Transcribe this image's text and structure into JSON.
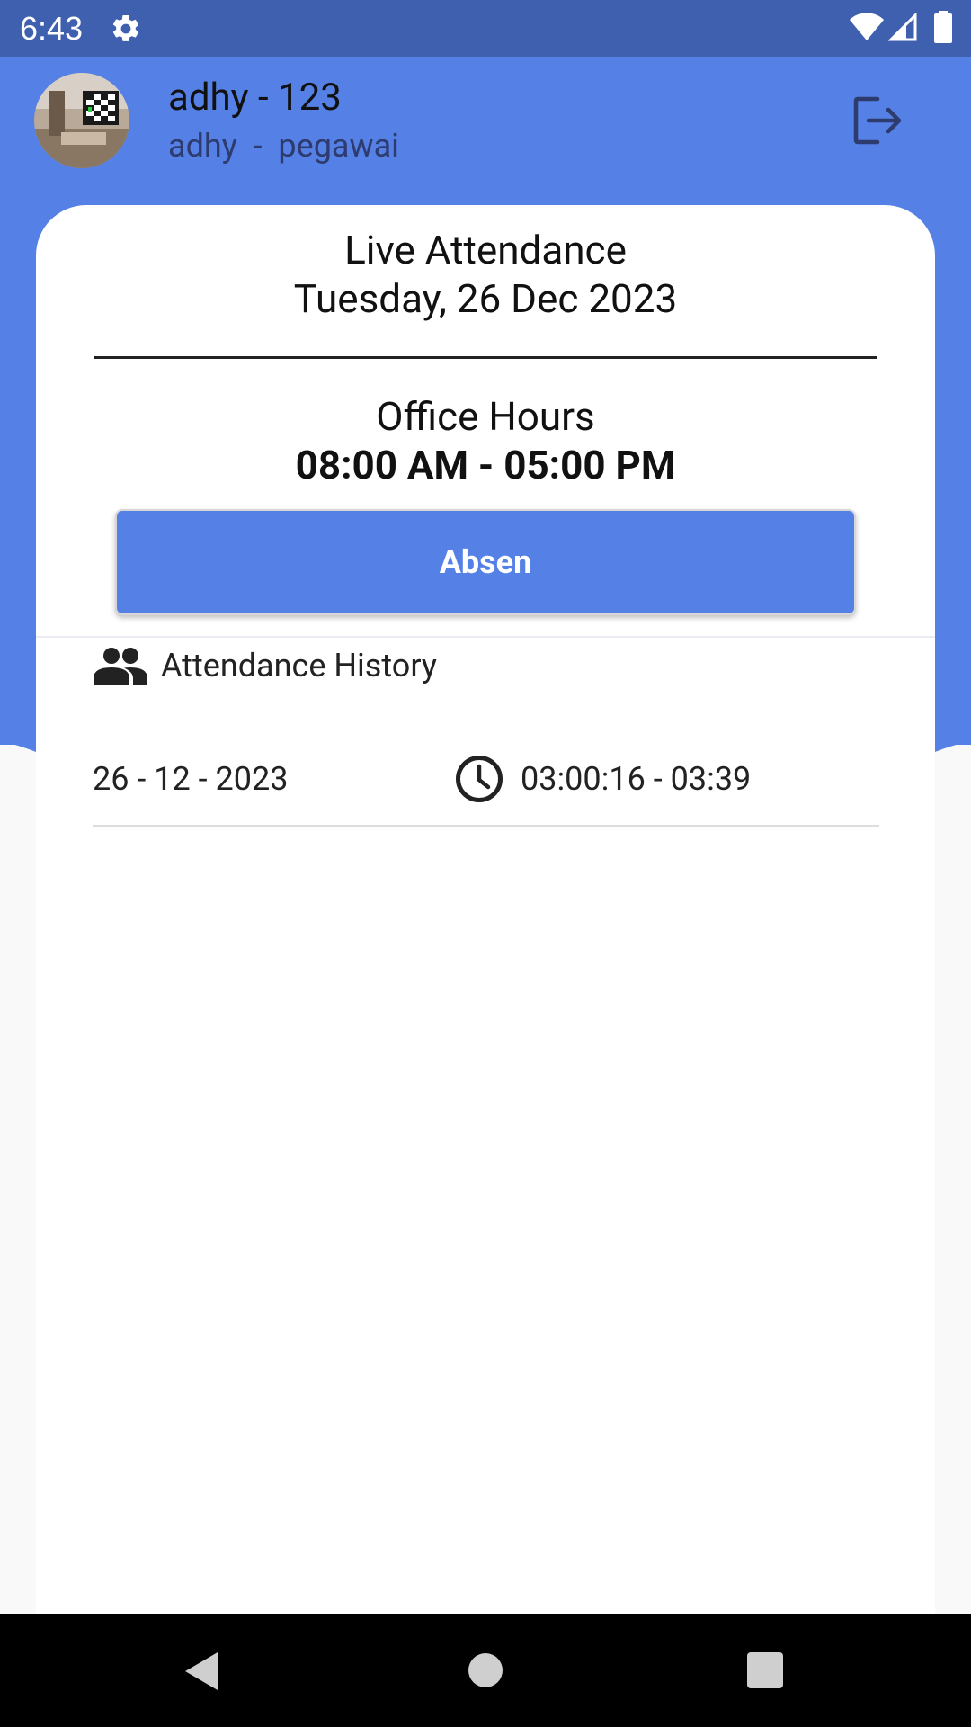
{
  "status_bar": {
    "time": "6:43",
    "icons": [
      "gear-icon",
      "wifi-icon",
      "signal-icon",
      "battery-icon"
    ]
  },
  "header": {
    "name": "adhy - 123",
    "subtitle": "adhy  -  pegawai",
    "avatar_icon": "avatar",
    "logout_icon": "logout-icon"
  },
  "card": {
    "title": "Live Attendance",
    "date": "Tuesday, 26 Dec 2023",
    "office_hours_label": "Office Hours",
    "office_hours_value": "08:00 AM - 05:00 PM",
    "absen_button_label": "Absen"
  },
  "history": {
    "label": "Attendance History",
    "icon": "people-icon",
    "rows": [
      {
        "date": "26 - 12 - 2023",
        "icon": "clock-icon",
        "time": "03:00:16 - 03:39"
      }
    ]
  },
  "nav": {
    "icons": [
      "back-icon",
      "home-icon",
      "recent-apps-icon"
    ]
  },
  "colors": {
    "header_blue": "#5580e5",
    "status_bar_blue": "#3f5faf",
    "background": "#f9f9f9",
    "card": "#ffffff"
  }
}
